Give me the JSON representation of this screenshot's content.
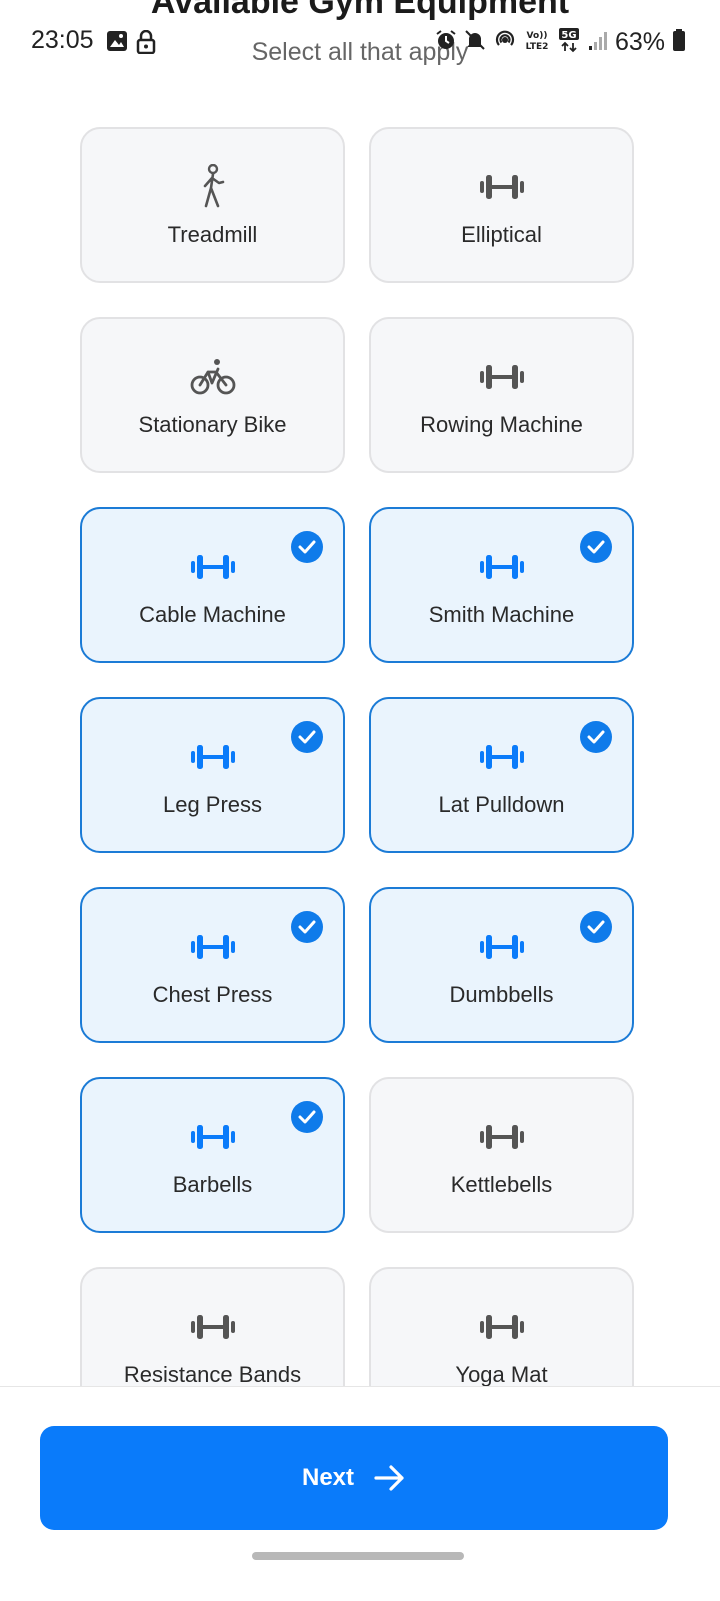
{
  "status_bar": {
    "time": "23:05",
    "battery": "63%",
    "network_badges": [
      "VoLTE2",
      "5G"
    ],
    "icons": [
      "image-icon",
      "lock-icon",
      "alarm-icon",
      "mute-icon",
      "hotspot-icon",
      "signal-icon",
      "battery-icon"
    ]
  },
  "header": {
    "title": "Available Gym Equipment",
    "subtitle": "Select all that apply"
  },
  "colors": {
    "accent": "#0a7bfa",
    "selected_border": "#1b7bd6",
    "selected_bg": "#eaf4fd",
    "card_bg": "#f6f7f9",
    "icon_gray": "#555555"
  },
  "equipment": [
    {
      "label": "Treadmill",
      "icon": "walking-person-icon",
      "selected": false
    },
    {
      "label": "Elliptical",
      "icon": "dumbbell-icon",
      "selected": false
    },
    {
      "label": "Stationary Bike",
      "icon": "bicycle-icon",
      "selected": false
    },
    {
      "label": "Rowing Machine",
      "icon": "dumbbell-icon",
      "selected": false
    },
    {
      "label": "Cable Machine",
      "icon": "dumbbell-icon",
      "selected": true
    },
    {
      "label": "Smith Machine",
      "icon": "dumbbell-icon",
      "selected": true
    },
    {
      "label": "Leg Press",
      "icon": "dumbbell-icon",
      "selected": true
    },
    {
      "label": "Lat Pulldown",
      "icon": "dumbbell-icon",
      "selected": true
    },
    {
      "label": "Chest Press",
      "icon": "dumbbell-icon",
      "selected": true
    },
    {
      "label": "Dumbbells",
      "icon": "dumbbell-icon",
      "selected": true
    },
    {
      "label": "Barbells",
      "icon": "dumbbell-icon",
      "selected": true
    },
    {
      "label": "Kettlebells",
      "icon": "dumbbell-icon",
      "selected": false
    },
    {
      "label": "Resistance Bands",
      "icon": "dumbbell-icon",
      "selected": false
    },
    {
      "label": "Yoga Mat",
      "icon": "dumbbell-icon",
      "selected": false
    }
  ],
  "footer": {
    "next_label": "Next"
  }
}
